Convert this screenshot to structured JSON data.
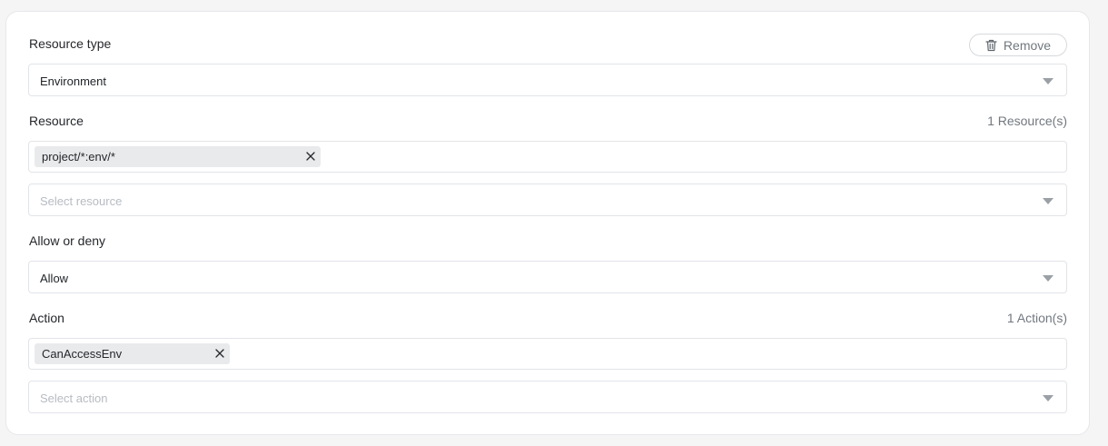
{
  "resource_type": {
    "label": "Resource type",
    "remove_label": "Remove",
    "value": "Environment"
  },
  "resource": {
    "label": "Resource",
    "count": "1 Resource(s)",
    "chips": [
      "project/*:env/*"
    ],
    "select_placeholder": "Select resource"
  },
  "allow_or_deny": {
    "label": "Allow or deny",
    "value": "Allow"
  },
  "action": {
    "label": "Action",
    "count": "1 Action(s)",
    "chips": [
      "CanAccessEnv"
    ],
    "select_placeholder": "Select action"
  },
  "icons": {
    "remove": "trash-icon",
    "dropdown": "caret-down-icon",
    "chip_remove": "close-icon"
  }
}
